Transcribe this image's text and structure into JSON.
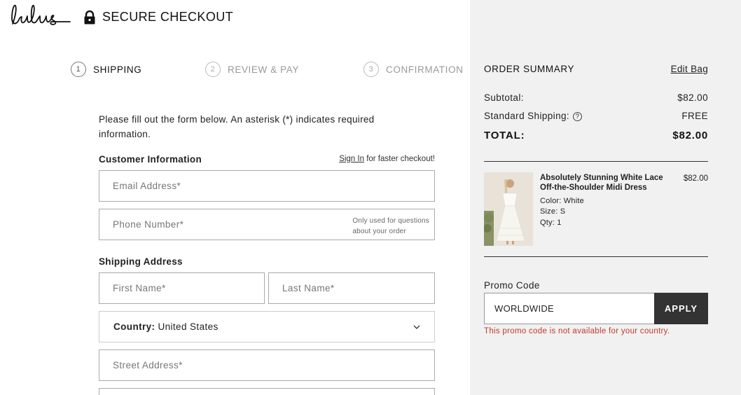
{
  "header": {
    "logo_icon": "lulus-script-logo",
    "lock_icon": "lock-icon",
    "secure_label": "SECURE CHECKOUT"
  },
  "steps": [
    {
      "num": "1",
      "label": "SHIPPING",
      "state": "active"
    },
    {
      "num": "2",
      "label": "REVIEW & PAY",
      "state": "inactive"
    },
    {
      "num": "3",
      "label": "CONFIRMATION",
      "state": "inactive"
    }
  ],
  "form": {
    "intro": "Please fill out the form below. An asterisk (*) indicates required information.",
    "customer_heading": "Customer Information",
    "sign_in_link": "Sign In",
    "sign_in_suffix": " for faster checkout!",
    "email_placeholder": "Email Address*",
    "phone_placeholder": "Phone Number*",
    "phone_hint_1": "Only used for questions",
    "phone_hint_2": "about your order",
    "shipping_heading": "Shipping Address",
    "first_name_placeholder": "First Name*",
    "last_name_placeholder": "Last Name*",
    "country_label": "Country:",
    "country_value": "United States",
    "street_placeholder": "Street Address*"
  },
  "summary": {
    "title": "ORDER SUMMARY",
    "edit_bag": "Edit Bag",
    "subtotal_label": "Subtotal:",
    "subtotal_value": "$82.00",
    "shipping_label": "Standard Shipping:",
    "shipping_value": "FREE",
    "total_label": "TOTAL:",
    "total_value": "$82.00",
    "item": {
      "name": "Absolutely Stunning White Lace Off-the-Shoulder Midi Dress",
      "price": "$82.00",
      "color": "Color: White",
      "size": "Size: S",
      "qty": "Qty: 1"
    },
    "promo_label": "Promo Code",
    "promo_value": "WORLDWIDE",
    "apply_label": "APPLY",
    "promo_error": "This promo code is not available for your country."
  },
  "colors": {
    "summary_bg": "#f1f1f1",
    "apply_bg": "#333333",
    "error": "#c0392b"
  }
}
